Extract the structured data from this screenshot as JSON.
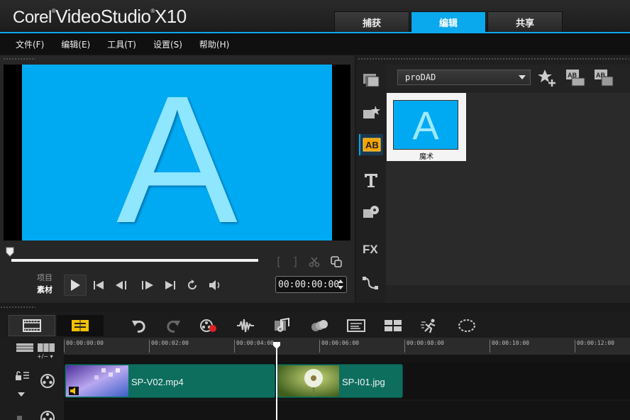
{
  "app": {
    "title_brand": "Corel",
    "title_product": "VideoStudio",
    "title_version": "X10"
  },
  "tabs": [
    {
      "label": "捕获",
      "active": false
    },
    {
      "label": "编辑",
      "active": true
    },
    {
      "label": "共享",
      "active": false
    }
  ],
  "menu": [
    "文件(F)",
    "编辑(E)",
    "工具(T)",
    "设置(S)",
    "帮助(H)"
  ],
  "player": {
    "preview_letter": "A",
    "mode_project": "项目",
    "mode_clip": "素材",
    "timecode": "00:00:00:00",
    "trim_in": "[",
    "trim_out": "]"
  },
  "library": {
    "folder": "proDAD",
    "items": [
      {
        "caption": "魔术",
        "thumb_letter": "A"
      }
    ]
  },
  "timeline": {
    "ruler_ticks": [
      "00:00:00:00",
      "00:00:02:00",
      "00:00:04:00",
      "00:00:06:00",
      "00:00:08:00",
      "00:00:10:00",
      "00:00:12:00"
    ],
    "clips": [
      {
        "name": "SP-V02.mp4"
      },
      {
        "name": "SP-I01.jpg"
      }
    ],
    "track_add_label": "+/−"
  },
  "colors": {
    "accent": "#0aa8ec",
    "clip": "#0d6e5e",
    "preview_bg": "#00aaf2"
  }
}
